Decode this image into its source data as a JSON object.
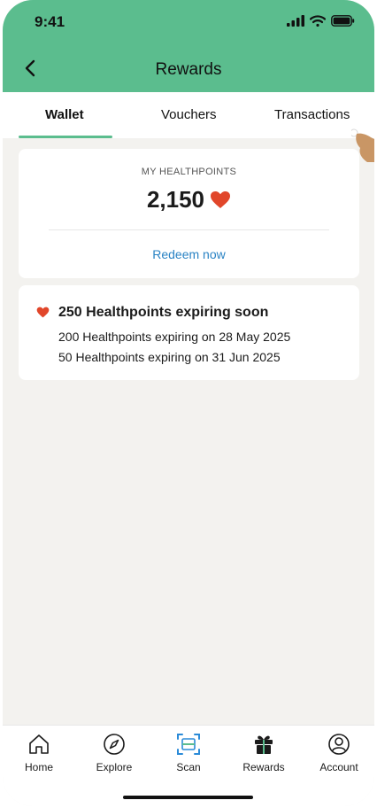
{
  "status_bar": {
    "time": "9:41"
  },
  "header": {
    "title": "Rewards"
  },
  "tabs": [
    {
      "label": "Wallet",
      "active": true
    },
    {
      "label": "Vouchers",
      "active": false
    },
    {
      "label": "Transactions",
      "active": false
    }
  ],
  "healthpoints": {
    "label": "MY HEALTHPOINTS",
    "value": "2,150",
    "redeem_label": "Redeem now"
  },
  "expiring": {
    "title": "250 Healthpoints expiring soon",
    "lines": [
      "200 Healthpoints expiring on 28 May 2025",
      "50 Healthpoints expiring on 31 Jun 2025"
    ]
  },
  "bottom_nav": [
    {
      "label": "Home",
      "icon": "home-icon"
    },
    {
      "label": "Explore",
      "icon": "compass-icon"
    },
    {
      "label": "Scan",
      "icon": "scan-icon"
    },
    {
      "label": "Rewards",
      "icon": "gift-icon"
    },
    {
      "label": "Account",
      "icon": "account-icon"
    }
  ],
  "colors": {
    "brand_green": "#5bbd8e",
    "heart": "#e1462a",
    "link_blue": "#2a83c4",
    "scan_blue": "#2b8bd8",
    "background": "#f3f2ef"
  }
}
